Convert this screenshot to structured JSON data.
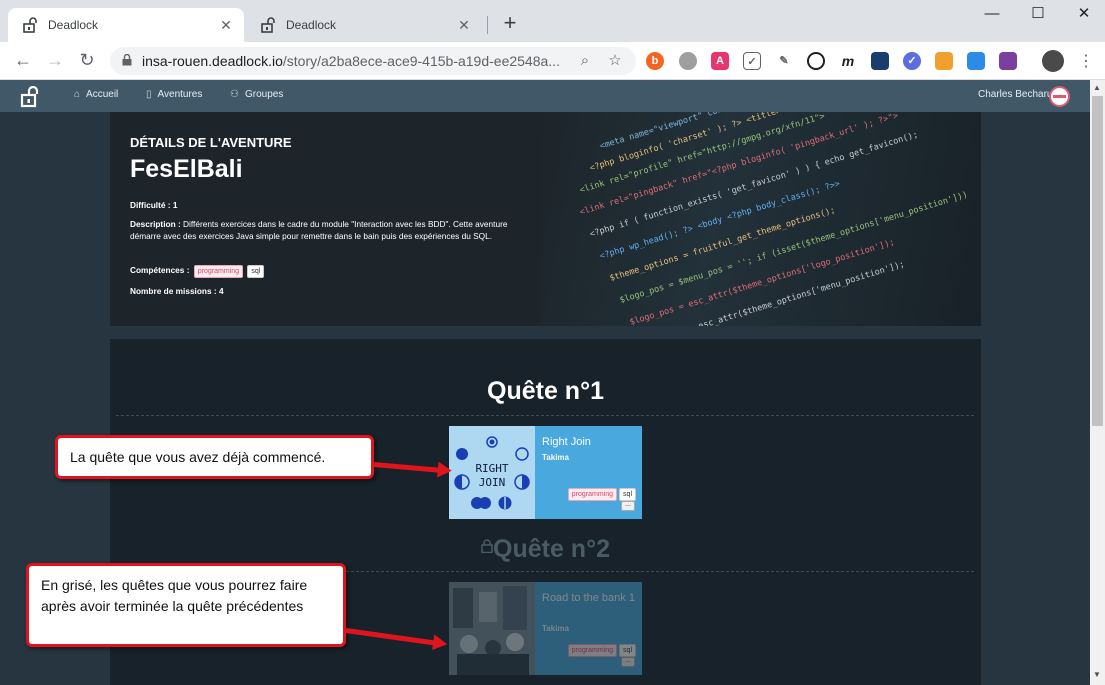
{
  "browser": {
    "tabs": [
      {
        "title": "Deadlock",
        "active": true
      },
      {
        "title": "Deadlock",
        "active": false
      }
    ],
    "new_tab": "+",
    "url_host": "insa-rouen.deadlock.io",
    "url_path": "/story/a2ba8ece-ace9-415b-a19d-ee2548a..."
  },
  "nav": {
    "links": [
      "Accueil",
      "Aventures",
      "Groupes"
    ],
    "user_name": "Charles Becharu"
  },
  "hero": {
    "subtitle": "DÉTAILS DE L'AVENTURE",
    "title": "FesElBali",
    "difficulty_label": "Difficulté :",
    "difficulty_value": "1",
    "description_label": "Description :",
    "description_text": "Différents exercices dans le cadre du module \"Interaction avec les BDD\". Cette aventure démarre avec des exercices Java simple pour remettre dans le bain puis des expériences du SQL.",
    "skills_label": "Compétences :",
    "skills": [
      "programming",
      "sql"
    ],
    "missions_label": "Nombre de missions :",
    "missions_value": "4"
  },
  "quests": [
    {
      "title": "Quête n°1",
      "locked": false,
      "card": {
        "title": "Right Join",
        "org": "Takima",
        "tags": [
          "programming",
          "sql"
        ],
        "more": "...",
        "thumb_text_1": "RIGHT",
        "thumb_text_2": "JOIN"
      }
    },
    {
      "title": "Quête n°2",
      "locked": true,
      "card": {
        "title": "Road to the bank 1",
        "org": "Takima",
        "tags": [
          "programming",
          "sql"
        ],
        "more": "..."
      }
    }
  ],
  "annotations": {
    "callout_1": "La quête que vous avez déjà commencé.",
    "callout_2": "En grisé, les quêtes que vous pourrez faire après avoir terminée la quête précédentes"
  },
  "colors": {
    "accent_red": "#e0141c",
    "card_blue": "#49a9de",
    "navbar": "#405868",
    "page_bg": "#263540"
  }
}
